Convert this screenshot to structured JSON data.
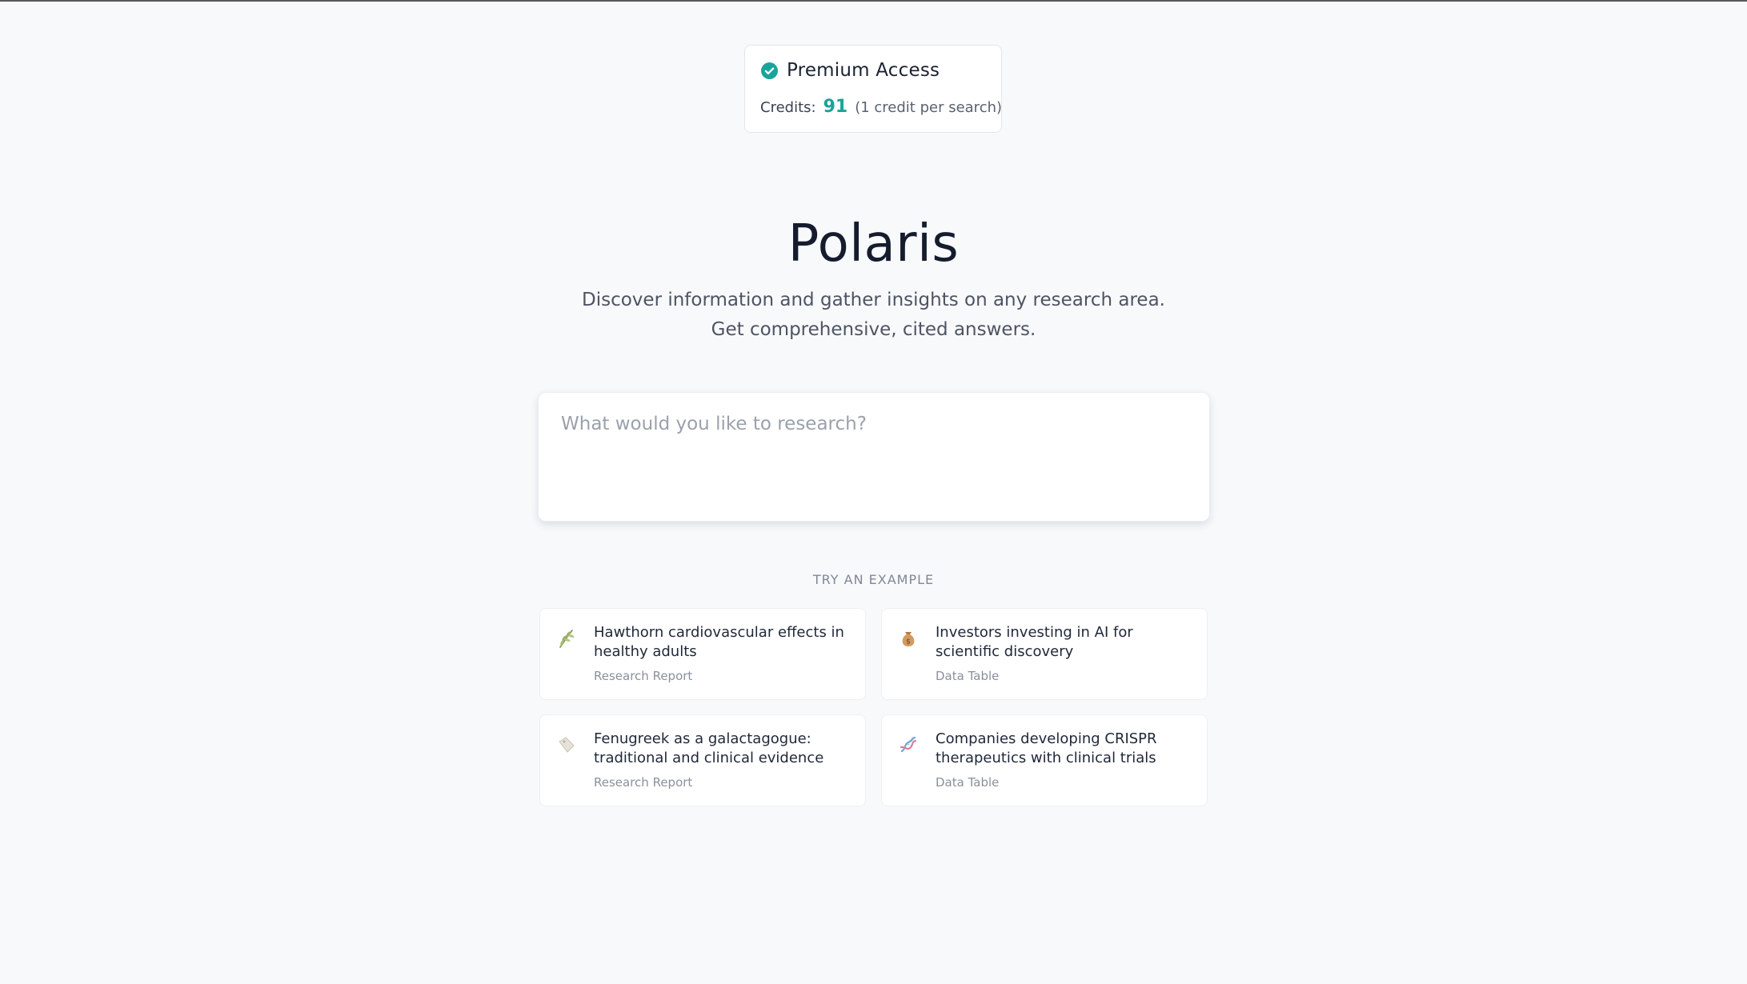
{
  "header": {
    "premium": {
      "title": "Premium Access",
      "check_icon": "check-circle-icon",
      "credits_label": "Credits:",
      "credits_value": "91",
      "credits_note": "(1 credit per search)"
    }
  },
  "hero": {
    "title": "Polaris",
    "subtitle_line1": "Discover information and gather insights on any research area.",
    "subtitle_line2": "Get comprehensive, cited answers."
  },
  "search": {
    "placeholder": "What would you like to research?",
    "value": ""
  },
  "examples": {
    "heading": "TRY AN EXAMPLE",
    "items": [
      {
        "icon": "herb-icon",
        "title": "Hawthorn cardiovascular effects in healthy adults",
        "type": "Research Report"
      },
      {
        "icon": "money-bag-icon",
        "title": "Investors investing in AI for scientific discovery",
        "type": "Data Table"
      },
      {
        "icon": "seed-icon",
        "title": "Fenugreek as a galactagogue: traditional and clinical evidence",
        "type": "Research Report"
      },
      {
        "icon": "dna-icon",
        "title": "Companies developing CRISPR therapeutics with clinical trials",
        "type": "Data Table"
      }
    ]
  },
  "colors": {
    "background": "#f8f9fb",
    "accent": "#1aa39a",
    "text_primary": "#151c2e",
    "text_muted": "#8a909b"
  }
}
